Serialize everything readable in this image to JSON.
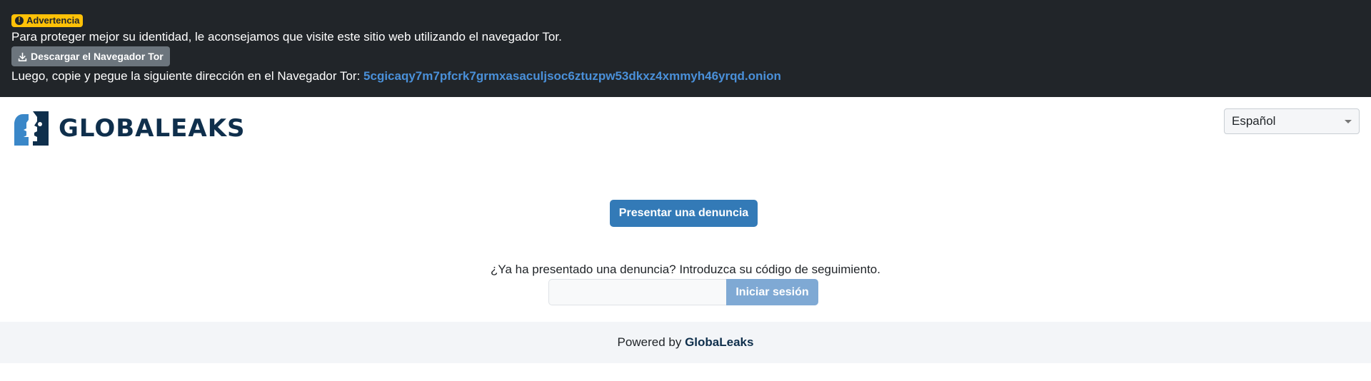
{
  "tor_banner": {
    "badge_label": "Advertencia",
    "message": "Para proteger mejor su identidad, le aconsejamos que visite este sitio web utilizando el navegador Tor.",
    "download_button": "Descargar el Navegador Tor",
    "onion_prefix": "Luego, copie y pegue la siguiente dirección en el Navegador Tor:",
    "onion_address": "5cgicaqy7m7pfcrk7grmxasaculjsoc6ztuzpw53dkxz4xmmyh46yrqd.onion"
  },
  "header": {
    "logo_text": "GLOBALEAKS",
    "language": "Español"
  },
  "main": {
    "submit_button": "Presentar una denuncia",
    "receipt_prompt": "¿Ya ha presentado una denuncia? Introduzca su código de seguimiento.",
    "receipt_value": "",
    "login_button": "Iniciar sesión"
  },
  "footer": {
    "powered_by": "Powered by",
    "brand": "GlobaLeaks"
  },
  "colors": {
    "banner_bg": "#212529",
    "warning": "#ffc107",
    "primary": "#337ab7",
    "brand_dark": "#0f2f4c",
    "logo_light": "#3a87c8"
  },
  "icons": [
    "exclamation-circle-icon",
    "download-icon",
    "globaleaks-logo-icon",
    "chevron-down-icon"
  ]
}
